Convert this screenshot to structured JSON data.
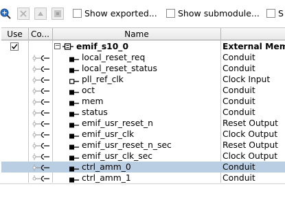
{
  "toolbar": {
    "show_exported_label": "Show exported...",
    "show_submodule_label": "Show submodule...",
    "third_checkbox_label": "S"
  },
  "table": {
    "headers": {
      "use": "Use",
      "connections": "Co...",
      "name": "Name"
    },
    "root": {
      "name": "emif_s10_0",
      "type": "External Mem",
      "use_checked": true,
      "expanded": true
    },
    "rows": [
      {
        "name": "local_reset_req",
        "type": "Conduit",
        "icon": "conduit-port-icon"
      },
      {
        "name": "local_reset_status",
        "type": "Conduit",
        "icon": "conduit-port-icon"
      },
      {
        "name": "pll_ref_clk",
        "type": "Clock Input",
        "icon": "clock-input-port-icon"
      },
      {
        "name": "oct",
        "type": "Conduit",
        "icon": "conduit-port-icon"
      },
      {
        "name": "mem",
        "type": "Conduit",
        "icon": "conduit-port-icon"
      },
      {
        "name": "status",
        "type": "Conduit",
        "icon": "conduit-port-icon"
      },
      {
        "name": "emif_usr_reset_n",
        "type": "Reset Output",
        "icon": "reset-output-port-icon"
      },
      {
        "name": "emif_usr_clk",
        "type": "Clock Output",
        "icon": "clock-output-port-icon"
      },
      {
        "name": "emif_usr_reset_n_sec",
        "type": "Reset Output",
        "icon": "reset-output-port-icon"
      },
      {
        "name": "emif_usr_clk_sec",
        "type": "Clock Output",
        "icon": "clock-output-port-icon"
      },
      {
        "name": "ctrl_amm_0",
        "type": "Conduit",
        "icon": "conduit-port-icon",
        "selected": true
      },
      {
        "name": "ctrl_amm_1",
        "type": "Conduit",
        "icon": "conduit-port-icon"
      }
    ]
  },
  "colors": {
    "selection": "#b9cde3",
    "accent": "#2a6fc9"
  }
}
